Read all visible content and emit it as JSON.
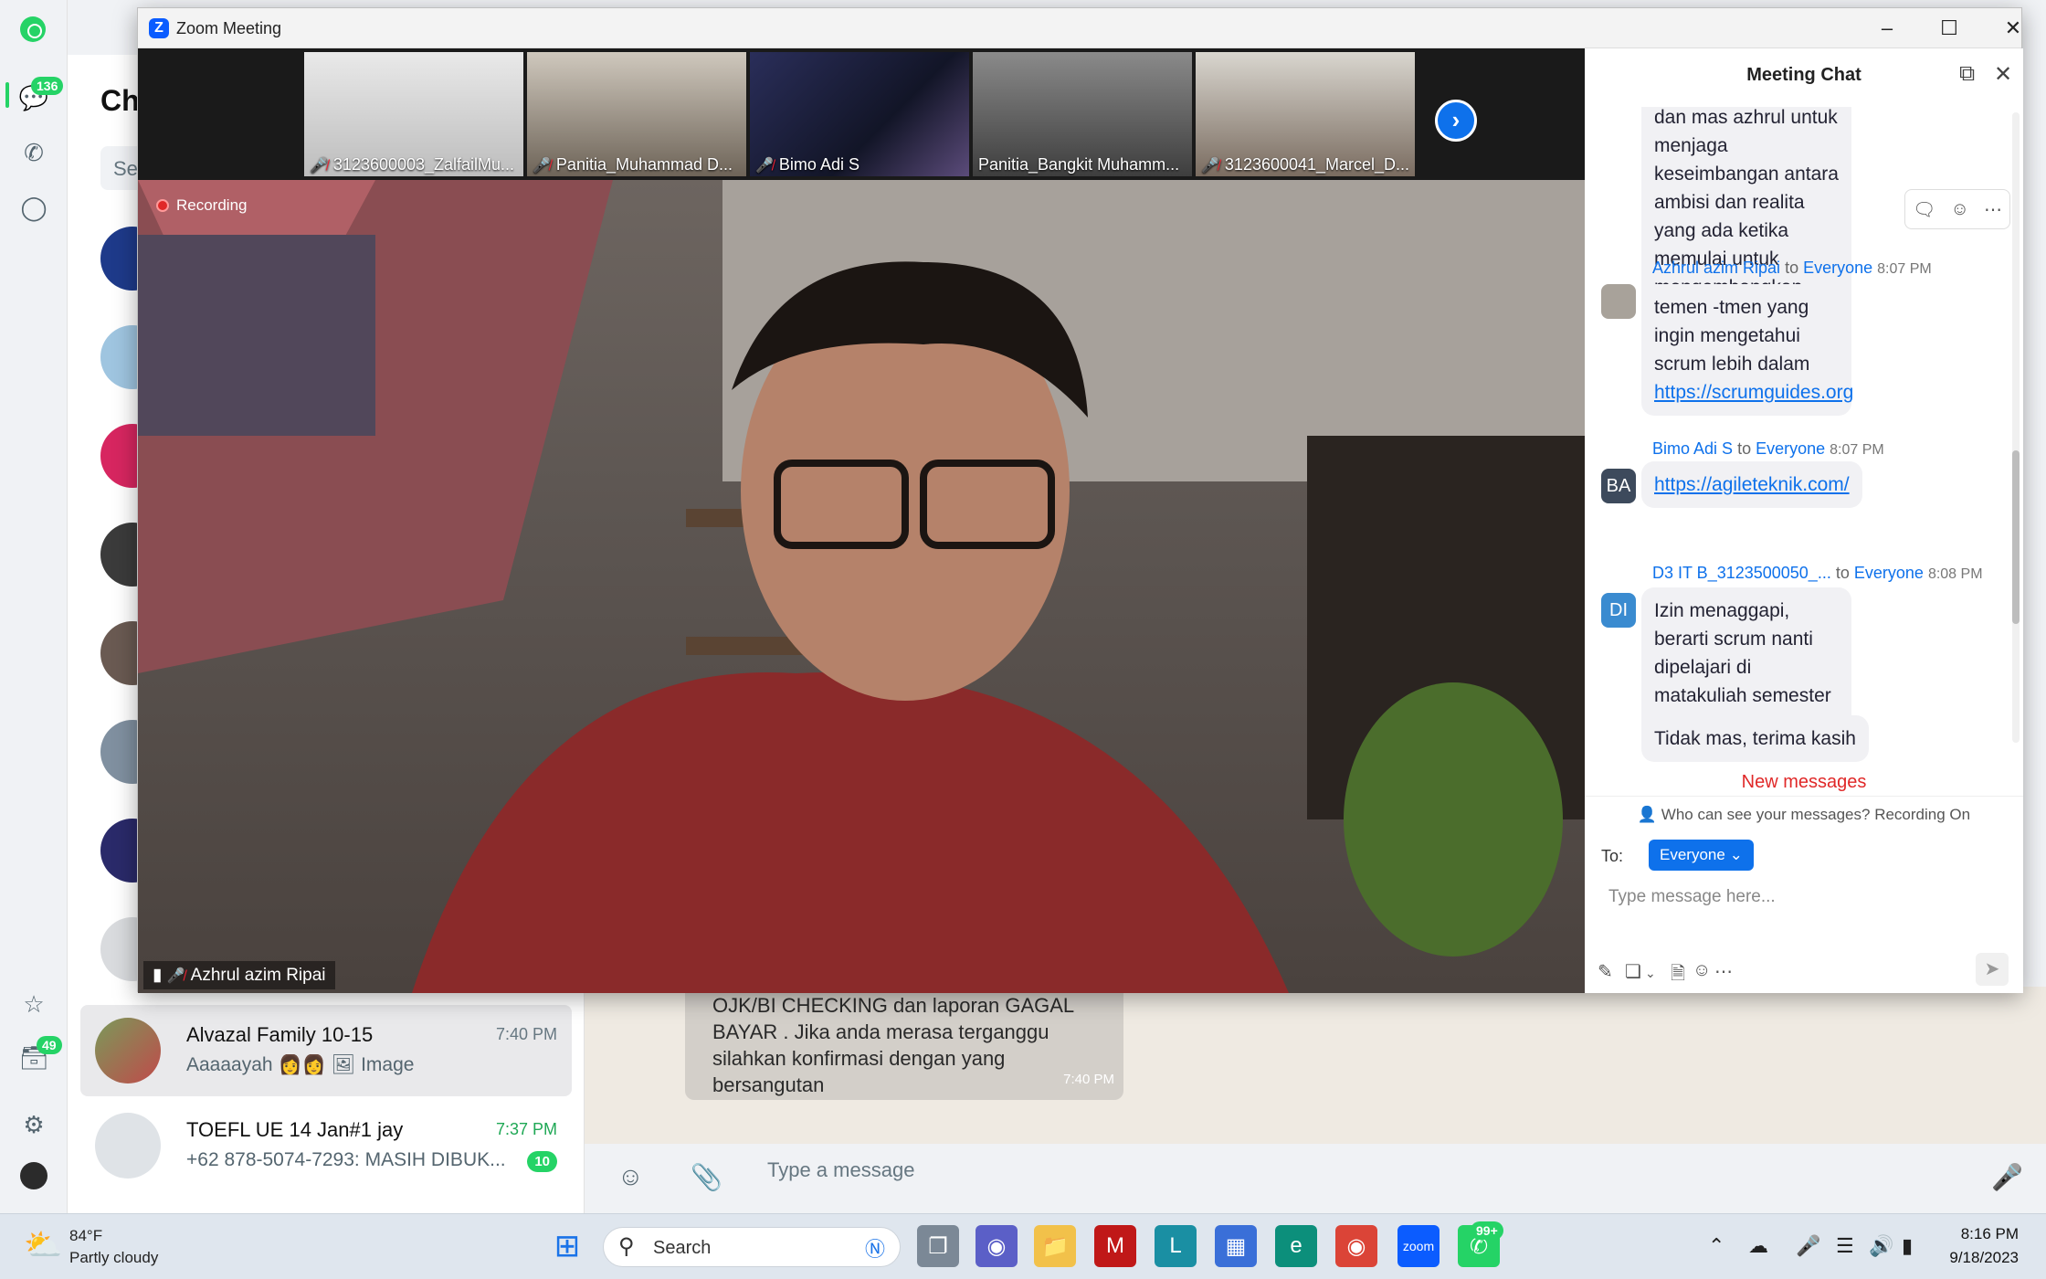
{
  "whatsapp": {
    "rail": {
      "chats_badge": "136",
      "archive_badge": "49"
    },
    "list_title": "Cha",
    "search_placeholder": "Se",
    "chats": [
      {
        "name": "Alvazal Family 10-15",
        "time": "7:40 PM",
        "preview_text": "Aaaaayah",
        "preview_media": "Image"
      },
      {
        "name": "TOEFL UE 14 Jan#1 jay",
        "time": "7:37 PM",
        "preview_sender": "+62 878-5074-7293:",
        "preview_text": "MASIH DIBUK...",
        "unread": "10"
      }
    ],
    "bubble_text": "OJK/BI CHECKING dan laporan GAGAL BAYAR . Jika anda merasa terganggu silahkan konfirmasi dengan yang bersangutan",
    "bubble_time": "7:40 PM",
    "composer_placeholder": "Type a message"
  },
  "zoom": {
    "window_title": "Zoom Meeting",
    "participants": [
      {
        "name": "3123600003_ZalfailMu...",
        "muted": true
      },
      {
        "name": "Panitia_Muhammad D...",
        "muted": true
      },
      {
        "name": "Bimo Adi S",
        "muted": true
      },
      {
        "name": "Panitia_Bangkit Muhamm...",
        "muted": false
      },
      {
        "name": "3123600041_Marcel_D...",
        "muted": true
      }
    ],
    "recording_label": "Recording",
    "active_speaker": "Azhrul azim Ripai"
  },
  "meeting_chat": {
    "title": "Meeting Chat",
    "messages": [
      {
        "sender": "",
        "to": "",
        "time": "",
        "avatar": "",
        "text": "dan mas azhrul untuk menjaga keseimbangan antara ambisi dan realita yang ada ketika memulai untuk mengembangkan sebuah bisnis?"
      },
      {
        "sender": "Azhrul azim Ripai",
        "to": "Everyone",
        "time": "8:07 PM",
        "avatar": "",
        "text": "temen -tmen yang ingin mengetahui scrum lebih dalam",
        "link": "https://scrumguides.org"
      },
      {
        "sender": "Bimo Adi S",
        "to": "Everyone",
        "time": "8:07 PM",
        "avatar": "BA",
        "link": "https://agileteknik.com/"
      },
      {
        "sender": "D3 IT B_3123500050_...",
        "to": "Everyone",
        "time": "8:08 PM",
        "avatar": "DI",
        "text": "Izin menaggapi, berarti scrum nanti dipelajari di matakuliah semester atas?",
        "text2": "Tidak mas, terima kasih"
      }
    ],
    "to_word": "to",
    "new_messages": "New messages",
    "privacy_note": "Who can see your messages? Recording On",
    "to_label": "To:",
    "recipient": "Everyone",
    "input_placeholder": "Type message here..."
  },
  "taskbar": {
    "temperature": "84°F",
    "weather": "Partly cloudy",
    "search_label": "Search",
    "whatsapp_badge": "99+",
    "time": "8:16 PM",
    "date": "9/18/2023"
  },
  "colors": {
    "zoom_blue": "#0e71eb",
    "whatsapp_green": "#25d366",
    "recording_red": "#e02828"
  }
}
